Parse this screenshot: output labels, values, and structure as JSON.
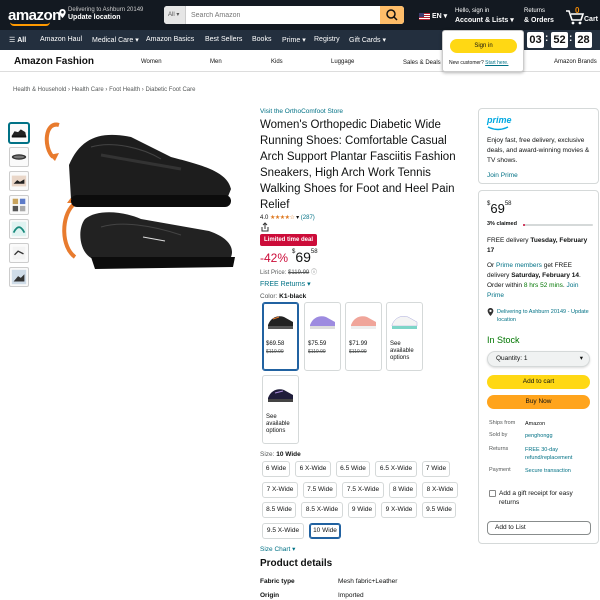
{
  "header": {
    "logo": "amazon",
    "deliver_line1": "Delivering to Ashburn 20149",
    "deliver_line2": "Update location",
    "search_category": "All",
    "search_placeholder": "Search Amazon",
    "language": "EN",
    "account_line1": "Hello, sign in",
    "account_line2": "Account & Lists",
    "orders_line1": "Returns",
    "orders_line2": "& Orders",
    "cart_count": "0",
    "cart_label": "Cart"
  },
  "subnav": {
    "all": "All",
    "items": [
      "Amazon Haul",
      "Medical Care",
      "Amazon Basics",
      "Best Sellers",
      "Books",
      "Prime",
      "Registry",
      "Gift Cards"
    ]
  },
  "signin_popover": {
    "button": "Sign in",
    "new_customer": "New customer?",
    "start_here": "Start here."
  },
  "timer": {
    "h": "03",
    "m": "52",
    "s": "28"
  },
  "fashion": {
    "title": "Amazon Fashion",
    "items": [
      "Women",
      "Men",
      "Kids",
      "Luggage",
      "Sales & Deals",
      "Amazon Brands"
    ]
  },
  "breadcrumbs": [
    "Health & Household",
    "Health Care",
    "Foot Health",
    "Diabetic Foot Care"
  ],
  "product": {
    "store_link": "Visit the OrthoComfoot Store",
    "title": "Women's Orthopedic Diabetic Wide Running Shoes: Comfortable Casual Arch Support Plantar Fasciitis Fashion Sneakers, High Arch Work Tennis Walking Shoes for Foot and Heel Pain Relief",
    "rating_value": "4.0",
    "stars": "★★★★☆",
    "review_count": "(287)",
    "deal_badge": "Limited time deal",
    "discount": "-42%",
    "price_symbol": "$",
    "price_whole": "69",
    "price_fraction": "58",
    "list_price_label": "List Price:",
    "list_price": "$119.99",
    "free_returns": "FREE Returns",
    "color_label": "Color:",
    "color_value": "K1-black",
    "size_label": "Size:",
    "size_value": "10 Wide",
    "size_chart": "Size Chart",
    "colors": [
      {
        "price": "$69.58",
        "old": "$119.99"
      },
      {
        "price": "$75.59",
        "old": "$119.99"
      },
      {
        "price": "$71.99",
        "old": "$119.99"
      },
      {
        "see": "See available options"
      },
      {
        "see": "See available options"
      }
    ],
    "sizes": [
      "6 Wide",
      "6 X-Wide",
      "6.5 Wide",
      "6.5 X-Wide",
      "7 Wide",
      "7 X-Wide",
      "7.5 Wide",
      "7.5 X-Wide",
      "8 Wide",
      "8 X-Wide",
      "8.5 Wide",
      "8.5 X-Wide",
      "9 Wide",
      "9 X-Wide",
      "9.5 Wide",
      "9.5 X-Wide",
      "10 Wide"
    ],
    "selected_size": "10 Wide"
  },
  "details": {
    "heading": "Product details",
    "rows": [
      {
        "k": "Fabric type",
        "v": "Mesh fabric+Leather"
      },
      {
        "k": "Origin",
        "v": "Imported"
      }
    ]
  },
  "prime_box": {
    "logo": "prime",
    "text": "Enjoy fast, free delivery, exclusive deals, and award-winning movies & TV shows.",
    "join": "Join Prime"
  },
  "buy_box": {
    "price_symbol": "$",
    "price_whole": "69",
    "price_fraction": "58",
    "claimed": "3% claimed",
    "claimed_fraction": 0.03,
    "free_delivery": "FREE delivery",
    "free_delivery_date": "Tuesday, February 17",
    "or": "Or",
    "prime_members": "Prime members",
    "get_free": "get FREE delivery",
    "fast_date": "Saturday, February 14",
    "order_within": "Order within",
    "countdown": "8 hrs 52 mins",
    "join_prime": "Join Prime",
    "deliver_to": "Delivering to Ashburn 20149 - Update location",
    "in_stock": "In Stock",
    "quantity": "Quantity: 1",
    "add_to_cart": "Add to cart",
    "buy_now": "Buy Now",
    "info": [
      {
        "k": "Ships from",
        "v": "Amazon"
      },
      {
        "k": "Sold by",
        "v": "penghongg"
      },
      {
        "k": "Returns",
        "v": "FREE 30-day refund/replacement"
      },
      {
        "k": "Payment",
        "v": "Secure transaction"
      }
    ],
    "gift_receipt": "Add a gift receipt for easy returns",
    "add_to_list": "Add to List"
  },
  "colors": {
    "nav_dark": "#131921",
    "nav_sub": "#232f3e",
    "accent_orange": "#febd69",
    "deal_red": "#cc0c39",
    "link": "#007185",
    "in_stock_green": "#007600",
    "cart_yellow": "#ffd814",
    "buy_orange": "#ffa41c"
  }
}
